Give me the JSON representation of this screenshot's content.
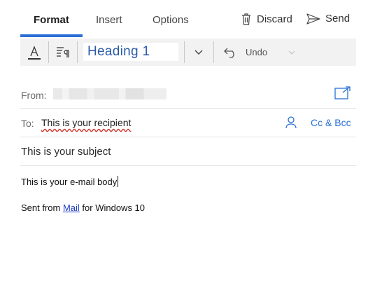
{
  "tabs": [
    {
      "label": "Format",
      "active": true
    },
    {
      "label": "Insert",
      "active": false
    },
    {
      "label": "Options",
      "active": false
    }
  ],
  "actions": {
    "discard_label": "Discard",
    "send_label": "Send"
  },
  "toolbar": {
    "style_value": "Heading 1",
    "undo_label": "Undo"
  },
  "from": {
    "label": "From:"
  },
  "to": {
    "label": "To:",
    "recipient": "This is your recipient",
    "cc_bcc_label": "Cc & Bcc"
  },
  "subject": "This is your subject",
  "body": "This is your e-mail body",
  "signature": {
    "prefix": "Sent from ",
    "link": "Mail",
    "suffix": " for Windows 10"
  },
  "colors": {
    "accent": "#2a6fd6",
    "heading_text": "#2a5aa8",
    "spellcheck": "#d0342c",
    "link": "#1d3ac4"
  },
  "icons": [
    "font-color-icon",
    "paragraph-format-icon",
    "chevron-down-icon",
    "undo-icon",
    "trash-icon",
    "send-icon",
    "popout-icon",
    "person-icon"
  ]
}
